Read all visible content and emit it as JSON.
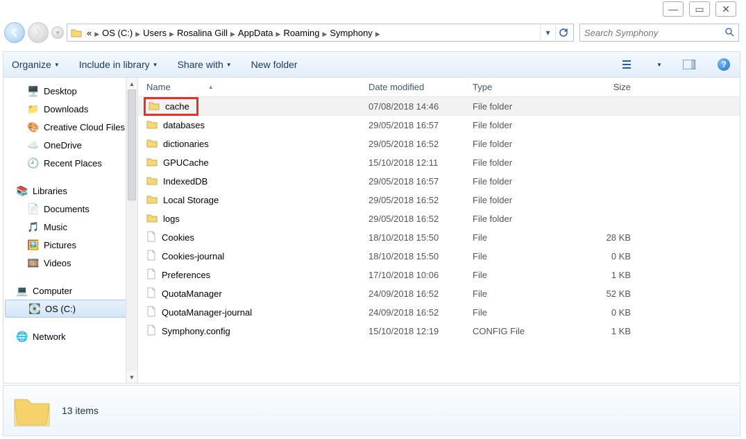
{
  "window_controls": {
    "minimize": "—",
    "maximize": "▭",
    "close": "✕"
  },
  "breadcrumb": {
    "ellipsis": "«",
    "segments": [
      "OS (C:)",
      "Users",
      "Rosalina Gill",
      "AppData",
      "Roaming",
      "Symphony"
    ]
  },
  "search": {
    "placeholder": "Search Symphony"
  },
  "toolbar": {
    "organize": "Organize",
    "include": "Include in library",
    "share": "Share with",
    "new_folder": "New folder"
  },
  "sidebar": {
    "items": [
      {
        "label": "Desktop",
        "icon": "desktop",
        "indent": 1
      },
      {
        "label": "Downloads",
        "icon": "folder",
        "indent": 1
      },
      {
        "label": "Creative Cloud Files",
        "icon": "cc",
        "indent": 1
      },
      {
        "label": "OneDrive",
        "icon": "onedrive",
        "indent": 1
      },
      {
        "label": "Recent Places",
        "icon": "recent",
        "indent": 1
      },
      {
        "gap": true
      },
      {
        "label": "Libraries",
        "icon": "libraries",
        "indent": 0
      },
      {
        "label": "Documents",
        "icon": "documents",
        "indent": 1
      },
      {
        "label": "Music",
        "icon": "music",
        "indent": 1
      },
      {
        "label": "Pictures",
        "icon": "pictures",
        "indent": 1
      },
      {
        "label": "Videos",
        "icon": "videos",
        "indent": 1
      },
      {
        "gap": true
      },
      {
        "label": "Computer",
        "icon": "computer",
        "indent": 0
      },
      {
        "label": "OS (C:)",
        "icon": "drive",
        "indent": 1,
        "selected": true
      },
      {
        "gap": true
      },
      {
        "label": "Network",
        "icon": "network",
        "indent": 0
      }
    ]
  },
  "columns": {
    "name": "Name",
    "date": "Date modified",
    "type": "Type",
    "size": "Size"
  },
  "files": [
    {
      "name": "cache",
      "date": "07/08/2018 14:46",
      "type": "File folder",
      "size": "",
      "icon": "folder",
      "highlighted": true,
      "selected": true
    },
    {
      "name": "databases",
      "date": "29/05/2018 16:57",
      "type": "File folder",
      "size": "",
      "icon": "folder"
    },
    {
      "name": "dictionaries",
      "date": "29/05/2018 16:52",
      "type": "File folder",
      "size": "",
      "icon": "folder"
    },
    {
      "name": "GPUCache",
      "date": "15/10/2018 12:11",
      "type": "File folder",
      "size": "",
      "icon": "folder"
    },
    {
      "name": "IndexedDB",
      "date": "29/05/2018 16:57",
      "type": "File folder",
      "size": "",
      "icon": "folder"
    },
    {
      "name": "Local Storage",
      "date": "29/05/2018 16:52",
      "type": "File folder",
      "size": "",
      "icon": "folder"
    },
    {
      "name": "logs",
      "date": "29/05/2018 16:52",
      "type": "File folder",
      "size": "",
      "icon": "folder"
    },
    {
      "name": "Cookies",
      "date": "18/10/2018 15:50",
      "type": "File",
      "size": "28 KB",
      "icon": "file"
    },
    {
      "name": "Cookies-journal",
      "date": "18/10/2018 15:50",
      "type": "File",
      "size": "0 KB",
      "icon": "file"
    },
    {
      "name": "Preferences",
      "date": "17/10/2018 10:06",
      "type": "File",
      "size": "1 KB",
      "icon": "file"
    },
    {
      "name": "QuotaManager",
      "date": "24/09/2018 16:52",
      "type": "File",
      "size": "52 KB",
      "icon": "file"
    },
    {
      "name": "QuotaManager-journal",
      "date": "24/09/2018 16:52",
      "type": "File",
      "size": "0 KB",
      "icon": "file"
    },
    {
      "name": "Symphony.config",
      "date": "15/10/2018 12:19",
      "type": "CONFIG File",
      "size": "1 KB",
      "icon": "file"
    }
  ],
  "status": {
    "count": "13 items"
  },
  "icons": {
    "desktop": "🖥️",
    "folder": "📁",
    "cc": "🎨",
    "onedrive": "☁️",
    "recent": "🕘",
    "libraries": "📚",
    "documents": "📄",
    "music": "🎵",
    "pictures": "🖼️",
    "videos": "🎞️",
    "computer": "💻",
    "drive": "💽",
    "network": "🌐",
    "file": "📄"
  }
}
